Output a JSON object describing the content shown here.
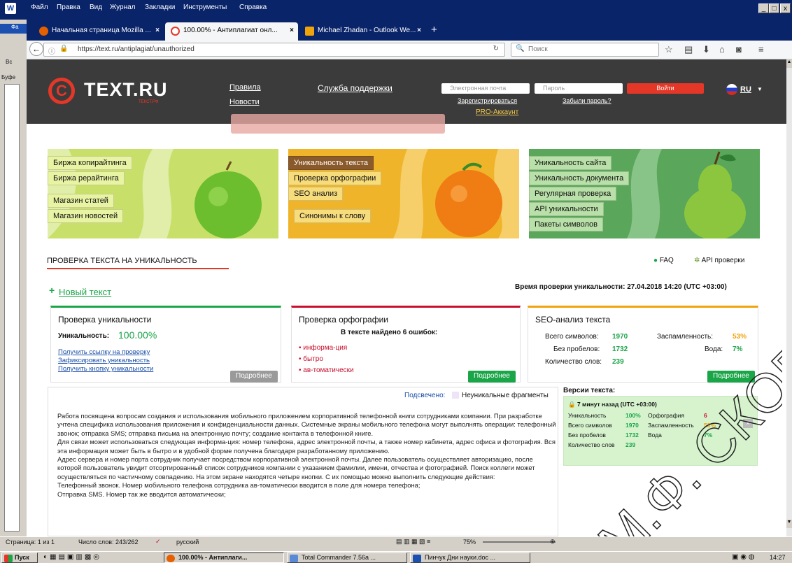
{
  "window": {
    "menu": [
      "Файл",
      "Правка",
      "Вид",
      "Журнал",
      "Закладки",
      "Инструменты",
      "Справка"
    ],
    "controls": [
      "_",
      "□",
      "x"
    ]
  },
  "tabs": [
    {
      "label": "Начальная страница Mozilla ...",
      "close": "×"
    },
    {
      "label": "100.00% - Антиплагиат онл...",
      "close": "×"
    },
    {
      "label": "Michael Zhadan - Outlook We...",
      "close": "×"
    }
  ],
  "new_tab": "+",
  "nav": {
    "url": "https://text.ru/antiplagiat/unauthorized",
    "search_placeholder": "Поиск"
  },
  "word_side": {
    "top_label": "Вс",
    "mid_label": "Буфе"
  },
  "site": {
    "logo": "TEXT.RU",
    "logo_sub": "ТЕКСТ.РФ",
    "links": {
      "rules": "Правила",
      "news": "Новости",
      "support": "Служба поддержки",
      "register": "Зарегистрироваться",
      "forgot": "Забыли пароль?",
      "pro": "PRO-Аккаунт"
    },
    "email_placeholder": "Электронная почта",
    "password_placeholder": "Пароль",
    "login": "Войти",
    "lang": "RU"
  },
  "banner": {
    "left": [
      "Биржа копирайтинга",
      "Биржа рерайтинга",
      "Магазин статей",
      "Магазин новостей"
    ],
    "mid": [
      "Уникальность текста",
      "Проверка орфографии",
      "SEO анализ",
      "Синонимы к слову"
    ],
    "right": [
      "Уникальность сайта",
      "Уникальность документа",
      "Регулярная проверка",
      "API уникальности",
      "Пакеты символов"
    ]
  },
  "section_title": "ПРОВЕРКА ТЕКСТА НА УНИКАЛЬНОСТЬ",
  "faq": "FAQ",
  "api": "API проверки",
  "new_text": "Новый текст",
  "check_time": "Время проверки уникальности: 27.04.2018 14:20 (UTC +03:00)",
  "uniq_card": {
    "title": "Проверка уникальности",
    "label": "Уникальность:",
    "value": "100.00%",
    "links": [
      "Получить ссылку на проверку",
      "Зафиксировать уникальность",
      "Получить кнопку уникальности"
    ],
    "more": "Подробнее"
  },
  "spell_card": {
    "title": "Проверка орфографии",
    "summary": "В тексте найдено 6 ошибок:",
    "errors": [
      "• информа-ция",
      "• бытро",
      "• ав-томатически"
    ],
    "more": "Подробнее"
  },
  "seo_card": {
    "title": "SEO-анализ текста",
    "chars_label": "Всего символов:",
    "chars": "1970",
    "nospace_label": "Без пробелов:",
    "nospace": "1732",
    "words_label": "Количество слов:",
    "words": "239",
    "spam_label": "Заспамленность:",
    "spam": "53%",
    "water_label": "Вода:",
    "water": "7%",
    "more": "Подробнее"
  },
  "highlight": {
    "label": "Подсвечено:",
    "value": "Неуникальные фрагменты"
  },
  "text_paragraphs": [
    "Работа посвящена вопросам создания и использования мобильного приложением корпоративной телефонной книги сотрудниками компании. При разработке учтена специфика использования приложения и конфиденциальности данных. Системные экраны мобильного телефона могут выполнять операции: телефонный звонок; отправка SMS; отправка письма на электронную почту; создание контакта в телефонной книге.",
    "Для связи может использоваться следующая информа-ция: номер телефона, адрес электронной почты, а также номер кабинета, адрес офиса и фотография. Вся эта информация может быть в бытро и в удобной форме получена благодаря разработанному приложению.",
    "Адрес сервера и номер порта сотрудник получает посредством корпоративной электронной почты. Далее пользователь осуществляет авторизацию, после которой пользователь увидит отсортированный список сотрудников компании с указанием фамилии, имени, отчества и фотографией. Поиск коллеги может осуществляться по частичному совпадению. На этом экране находятся четыре кнопки. С их помощью можно выполнить следующие действия:",
    "Телефонный звонок. Номер мобильного телефона сотрудника ав-томатически вводится в поле для номера телефона;",
    "Отправка SMS. Номер так же вводится автоматически;"
  ],
  "versions": {
    "title": "Версии текста:",
    "time": "7 минут назад (UTC +03:00)",
    "uniq_label": "Уникальность",
    "uniq": "100%",
    "chars_label": "Всего символов",
    "chars": "1970",
    "nospace_label": "Без пробелов",
    "nospace": "1732",
    "words_label": "Количество слов",
    "words": "239",
    "spell_label": "Орфография",
    "spell": "6",
    "spam_label": "Заспамленность",
    "spam": "53%",
    "water_label": "Вода",
    "water": "7%"
  },
  "status": {
    "page": "Страница: 1 из 1",
    "words": "Число слов: 243/262",
    "lang": "русский",
    "zoom": "75%"
  },
  "taskbar": {
    "start": "Пуск",
    "items": [
      "100.00% - Антиплаги...",
      "Total Commander 7.56a ...",
      "Пинчук Дни науки.doc ..."
    ],
    "time": "14:27"
  },
  "watermark": "М.Ф. СКОРИ",
  "colors": {
    "brand_red": "#e53727",
    "green": "#1aa548",
    "header": "#3b3b3b"
  }
}
